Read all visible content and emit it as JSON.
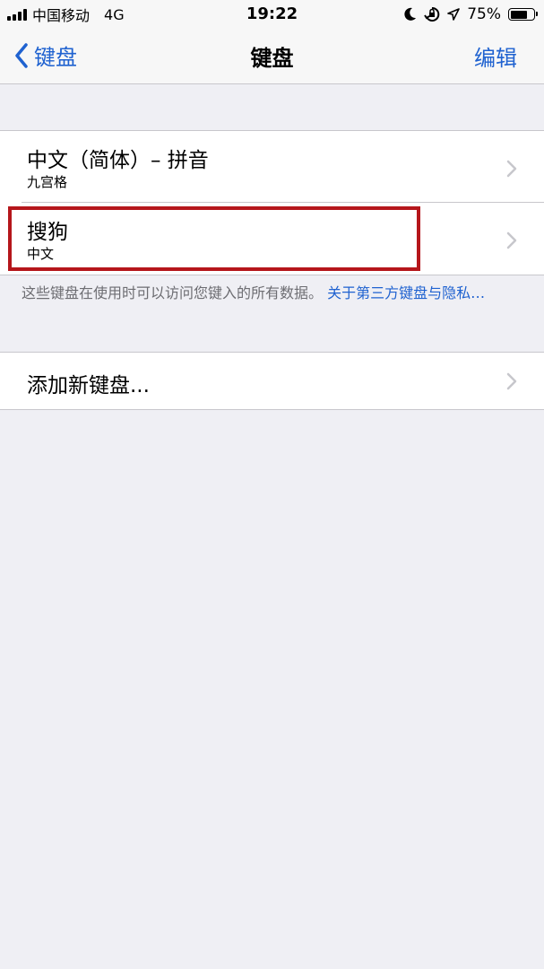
{
  "status_bar": {
    "carrier": "中国移动",
    "network": "4G",
    "time": "19:22",
    "battery_percent": "75%",
    "battery_level": 0.75
  },
  "nav": {
    "back_label": "键盘",
    "title": "键盘",
    "edit_label": "编辑"
  },
  "keyboards": [
    {
      "title": "中文（简体）– 拼音",
      "subtitle": "九宫格"
    },
    {
      "title": "搜狗",
      "subtitle": "中文"
    }
  ],
  "footer": {
    "note": "这些键盘在使用时可以访问您键入的所有数据。",
    "link": "关于第三方键盘与隐私…"
  },
  "add_keyboard": {
    "label": "添加新键盘..."
  },
  "colors": {
    "accent": "#1f62d0",
    "highlight": "#b5161b",
    "background": "#efeff4"
  },
  "icons": {
    "signal": "signal-bars-icon",
    "moon": "do-not-disturb-moon-icon",
    "rotation_lock": "rotation-lock-icon",
    "location": "location-arrow-icon",
    "battery": "battery-icon",
    "back": "chevron-left-icon",
    "disclosure": "chevron-right-icon"
  }
}
